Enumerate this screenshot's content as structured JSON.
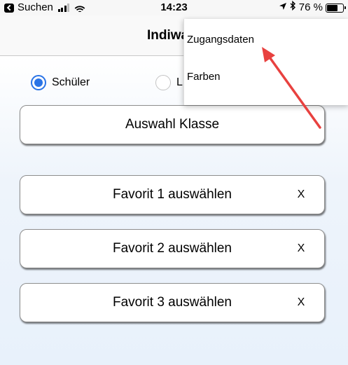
{
  "status_bar": {
    "back_label": "Suchen",
    "time": "14:23",
    "battery_text": "76 %",
    "battery_level": 0.76
  },
  "nav": {
    "title": "Indiware"
  },
  "radio_group": {
    "options": [
      {
        "label": "Schüler",
        "selected": true
      },
      {
        "label": "L",
        "selected": false
      }
    ]
  },
  "buttons": {
    "select_class": "Auswahl Klasse",
    "favorites": [
      {
        "label": "Favorit 1 auswählen",
        "clear": "X"
      },
      {
        "label": "Favorit 2 auswählen",
        "clear": "X"
      },
      {
        "label": "Favorit 3 auswählen",
        "clear": "X"
      }
    ]
  },
  "menu": {
    "items": [
      {
        "label": "Zugangsdaten"
      },
      {
        "label": "Farben"
      }
    ]
  },
  "colors": {
    "accent": "#2a74e6",
    "annotation_arrow": "#e8413f"
  },
  "icons": {
    "status_left": [
      "back-icon",
      "signal-icon",
      "wifi-icon"
    ],
    "status_right": [
      "location-icon",
      "bluetooth-icon",
      "battery-icon"
    ]
  }
}
